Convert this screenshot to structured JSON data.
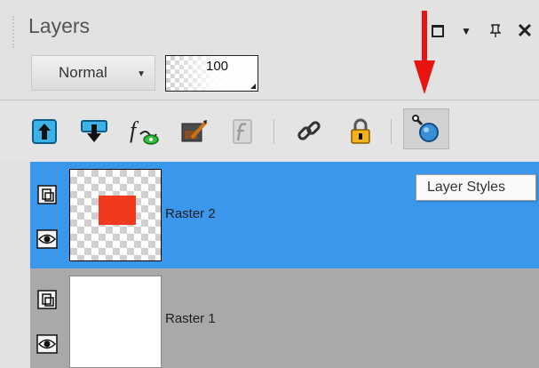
{
  "panel": {
    "title": "Layers",
    "window_buttons": [
      "maximize-icon",
      "dropdown-icon",
      "pin-icon",
      "close-icon"
    ]
  },
  "blend": {
    "mode": "Normal"
  },
  "opacity": {
    "value": "100"
  },
  "toolbar": {
    "icons": [
      "move-up-icon",
      "move-down-icon",
      "fx-effects-icon",
      "adjustment-icon",
      "mask-icon",
      "link-icon",
      "lock-icon",
      "layer-styles-icon"
    ]
  },
  "tooltip": {
    "text": "Layer Styles"
  },
  "layers": [
    {
      "name": "Raster 2",
      "selected": true
    },
    {
      "name": "Raster 1",
      "selected": false
    }
  ],
  "colors": {
    "selection": "#3b97ec",
    "accent_red": "#f03a1e",
    "arrow": "#e8140f"
  }
}
